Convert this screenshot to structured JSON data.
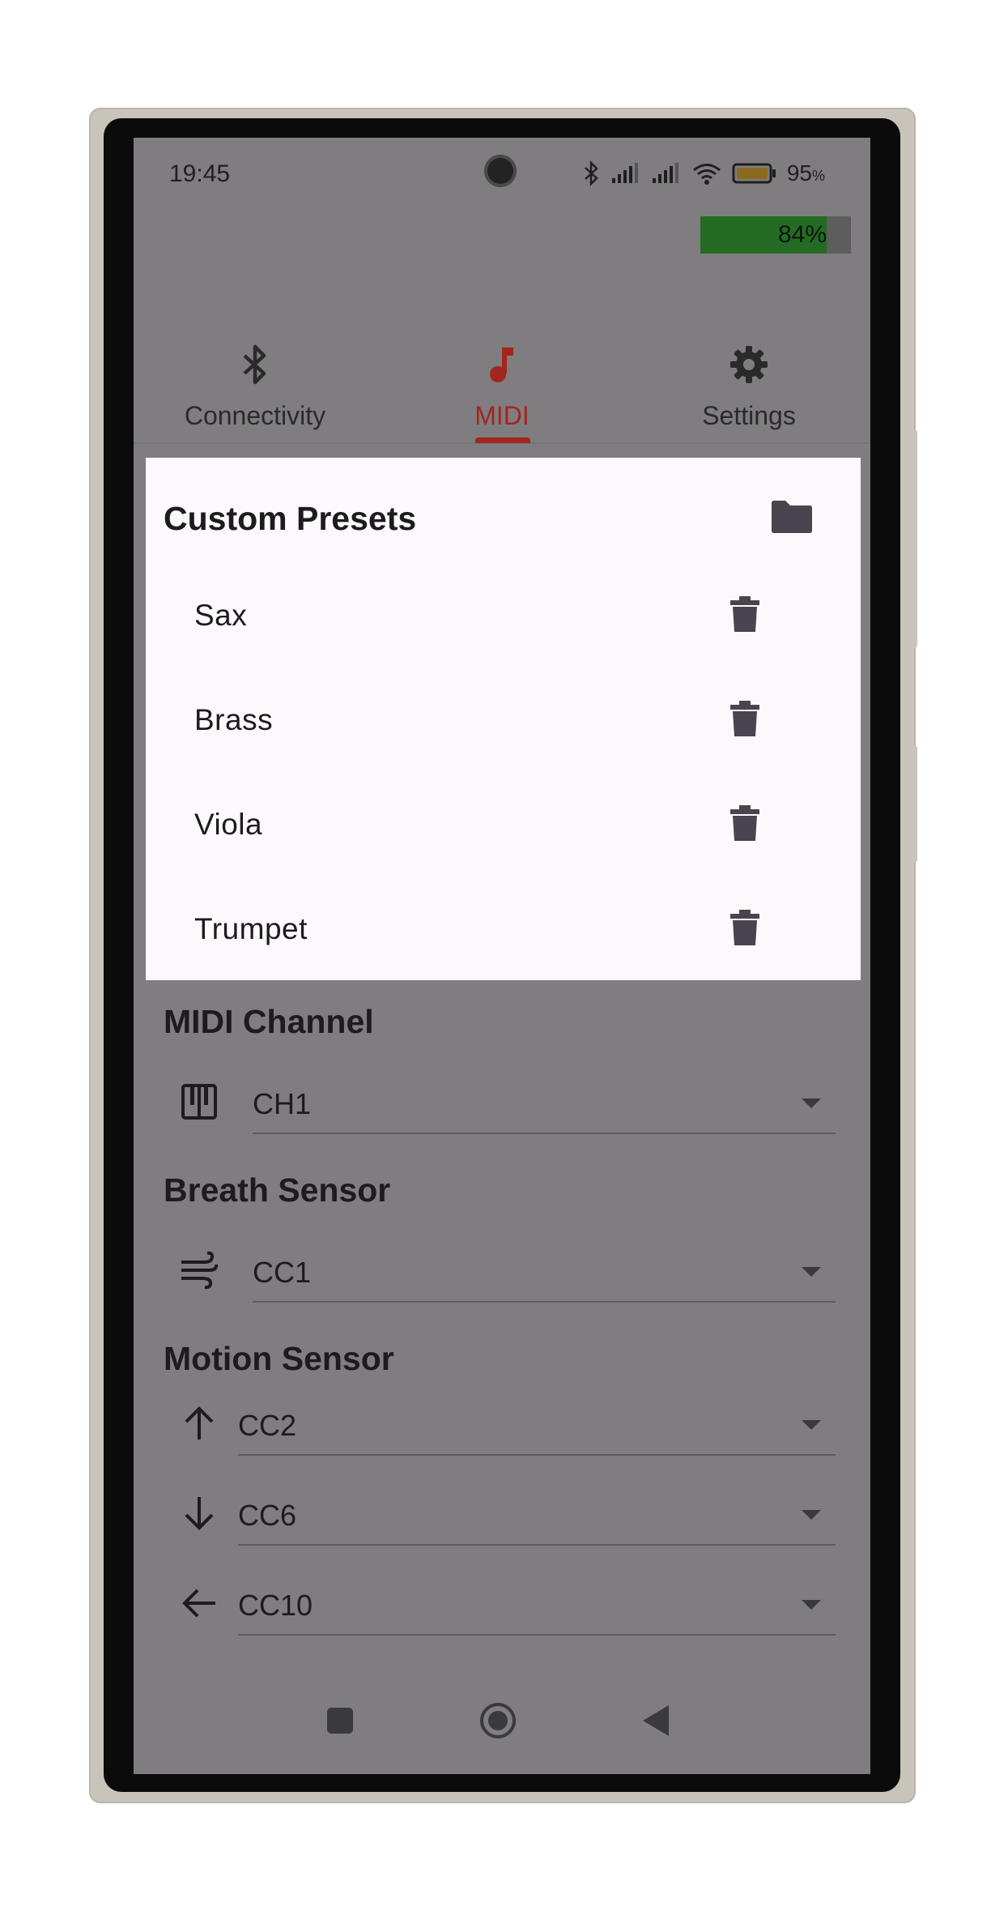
{
  "status_bar": {
    "time": "19:45",
    "battery_percent": "95",
    "battery_unit": "%"
  },
  "device_battery": {
    "label": "84%",
    "level": 0.84,
    "fill_color": "#246b24"
  },
  "tabs": [
    {
      "label": "Connectivity",
      "icon": "bluetooth-icon",
      "active": false
    },
    {
      "label": "MIDI",
      "icon": "music-note-icon",
      "active": true
    },
    {
      "label": "Settings",
      "icon": "gear-icon",
      "active": false
    }
  ],
  "accent_color": "#a2261d",
  "custom_presets": {
    "title": "Custom Presets",
    "folder_icon": "folder-icon",
    "items": [
      {
        "name": "Sax"
      },
      {
        "name": "Brass"
      },
      {
        "name": "Viola"
      },
      {
        "name": "Trumpet"
      }
    ]
  },
  "midi_channel": {
    "title": "MIDI Channel",
    "icon": "piano-icon",
    "value": "CH1"
  },
  "breath_sensor": {
    "title": "Breath Sensor",
    "icon": "wind-icon",
    "value": "CC1"
  },
  "motion_sensor": {
    "title": "Motion Sensor",
    "rows": [
      {
        "icon": "arrow-up-icon",
        "value": "CC2"
      },
      {
        "icon": "arrow-down-icon",
        "value": "CC6"
      },
      {
        "icon": "arrow-left-icon",
        "value": "CC10"
      }
    ]
  },
  "nav_bar": {
    "buttons": [
      "recents-icon",
      "home-icon",
      "back-icon"
    ]
  }
}
